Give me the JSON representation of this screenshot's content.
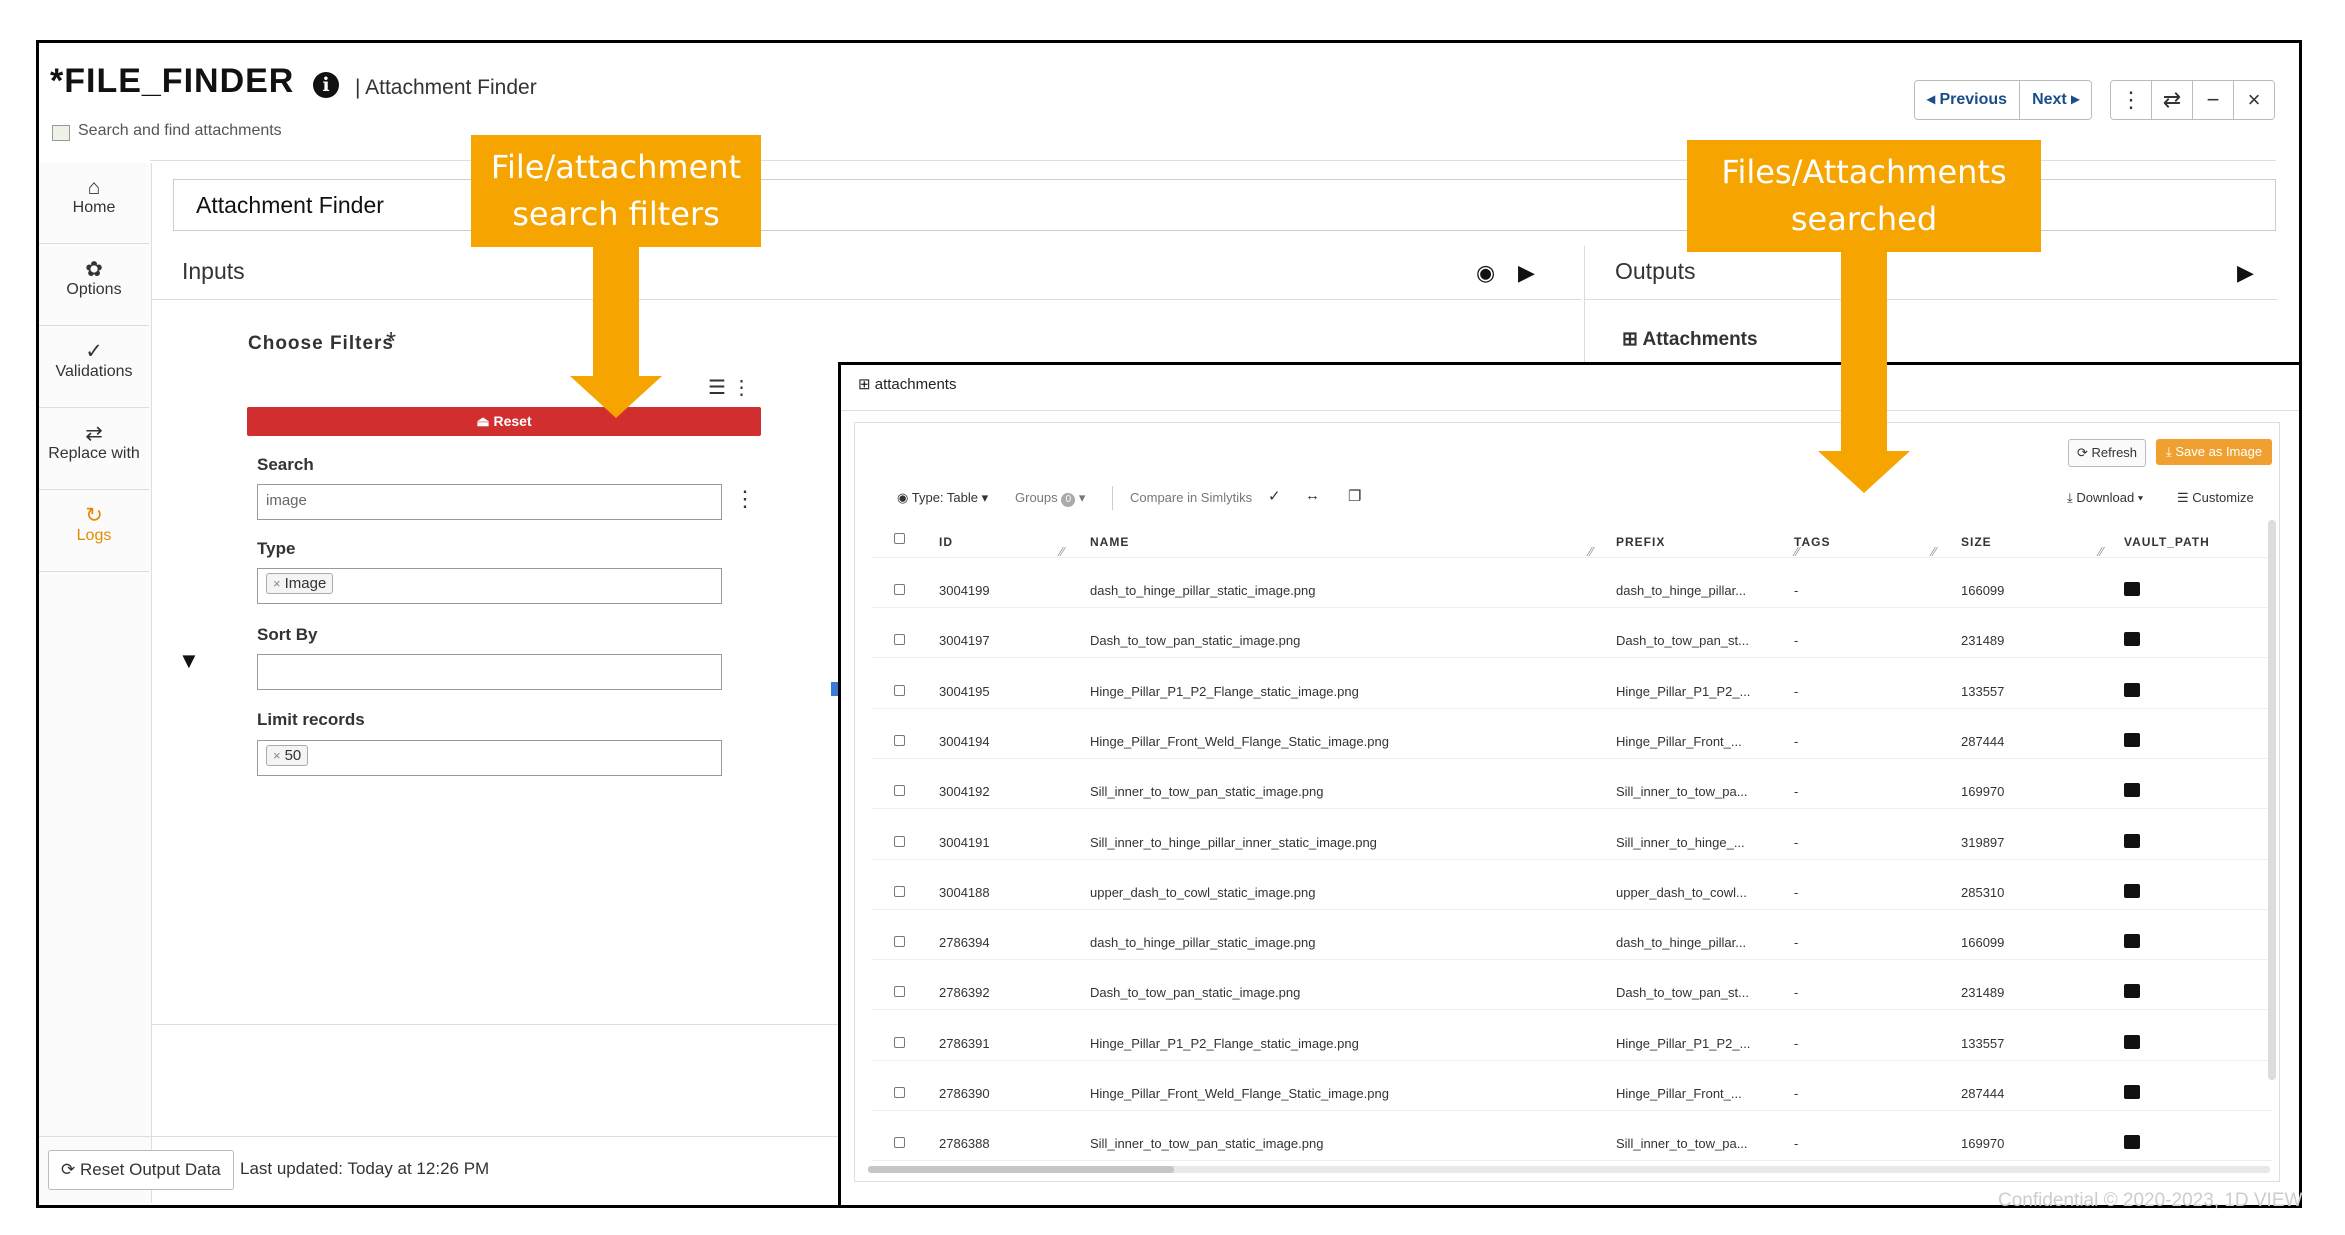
{
  "app": {
    "title": "*FILE_FINDER",
    "subtitle": "| Attachment Finder",
    "description": "Search and find attachments",
    "info_glyph": "i"
  },
  "nav": {
    "previous": "◂ Previous",
    "next": "Next ▸",
    "more_icon": "⋮",
    "swap_icon": "⇄",
    "minimize_icon": "−",
    "close_icon": "×"
  },
  "sidebar": {
    "items": [
      {
        "label": "Home",
        "icon": "⌂"
      },
      {
        "label": "Options",
        "icon": "✿"
      },
      {
        "label": "Validations",
        "icon": "✓"
      },
      {
        "label": "Replace with",
        "icon": "⇄"
      },
      {
        "label": "Logs",
        "icon": "↻"
      }
    ]
  },
  "name_field": {
    "value": "Attachment Finder"
  },
  "inputs": {
    "title": "Inputs",
    "choose_filters": "Choose Filters",
    "required_mark": "*",
    "reset_label": "⏏ Reset",
    "search_label": "Search",
    "search_value": "image",
    "type_label": "Type",
    "type_value": "Image",
    "sort_label": "Sort By",
    "sort_value": "",
    "limit_label": "Limit records",
    "limit_value": "50"
  },
  "outputs": {
    "title": "Outputs",
    "attachments_label": "Attachments"
  },
  "footer": {
    "reset_output": "Reset Output Data",
    "last_updated": "Last updated: Today at 12:26 PM"
  },
  "panel": {
    "title": "attachments",
    "refresh": "Refresh",
    "save_as_image": "Save as Image",
    "toolbar": {
      "type": "Type: Table ▾",
      "groups": "Groups",
      "groups_count": "0",
      "compare": "Compare in Simlytiks",
      "download": "Download ▾",
      "customize": "Customize"
    },
    "columns": [
      "ID",
      "NAME",
      "PREFIX",
      "TAGS",
      "SIZE",
      "VAULT_PATH"
    ],
    "rows": [
      {
        "id": "3004199",
        "name": "dash_to_hinge_pillar_static_image.png",
        "prefix": "dash_to_hinge_pillar...",
        "tags": "-",
        "size": "166099"
      },
      {
        "id": "3004197",
        "name": "Dash_to_tow_pan_static_image.png",
        "prefix": "Dash_to_tow_pan_st...",
        "tags": "-",
        "size": "231489"
      },
      {
        "id": "3004195",
        "name": "Hinge_Pillar_P1_P2_Flange_static_image.png",
        "prefix": "Hinge_Pillar_P1_P2_...",
        "tags": "-",
        "size": "133557"
      },
      {
        "id": "3004194",
        "name": "Hinge_Pillar_Front_Weld_Flange_Static_image.png",
        "prefix": "Hinge_Pillar_Front_...",
        "tags": "-",
        "size": "287444"
      },
      {
        "id": "3004192",
        "name": "Sill_inner_to_tow_pan_static_image.png",
        "prefix": "Sill_inner_to_tow_pa...",
        "tags": "-",
        "size": "169970"
      },
      {
        "id": "3004191",
        "name": "Sill_inner_to_hinge_pillar_inner_static_image.png",
        "prefix": "Sill_inner_to_hinge_...",
        "tags": "-",
        "size": "319897"
      },
      {
        "id": "3004188",
        "name": "upper_dash_to_cowl_static_image.png",
        "prefix": "upper_dash_to_cowl...",
        "tags": "-",
        "size": "285310"
      },
      {
        "id": "2786394",
        "name": "dash_to_hinge_pillar_static_image.png",
        "prefix": "dash_to_hinge_pillar...",
        "tags": "-",
        "size": "166099"
      },
      {
        "id": "2786392",
        "name": "Dash_to_tow_pan_static_image.png",
        "prefix": "Dash_to_tow_pan_st...",
        "tags": "-",
        "size": "231489"
      },
      {
        "id": "2786391",
        "name": "Hinge_Pillar_P1_P2_Flange_static_image.png",
        "prefix": "Hinge_Pillar_P1_P2_...",
        "tags": "-",
        "size": "133557"
      },
      {
        "id": "2786390",
        "name": "Hinge_Pillar_Front_Weld_Flange_Static_image.png",
        "prefix": "Hinge_Pillar_Front_...",
        "tags": "-",
        "size": "287444"
      },
      {
        "id": "2786388",
        "name": "Sill_inner_to_tow_pan_static_image.png",
        "prefix": "Sill_inner_to_tow_pa...",
        "tags": "-",
        "size": "169970"
      }
    ]
  },
  "callouts": {
    "filters": "File/attachment search filters",
    "searched": "Files/Attachments searched"
  },
  "page_footer": {
    "text": "Confidential © 2020-2023, 1D VIEW"
  },
  "colors": {
    "accent": "#f5a400",
    "reset": "#d12f2f",
    "logs": "#e58a00",
    "link": "#1a4e8a"
  }
}
